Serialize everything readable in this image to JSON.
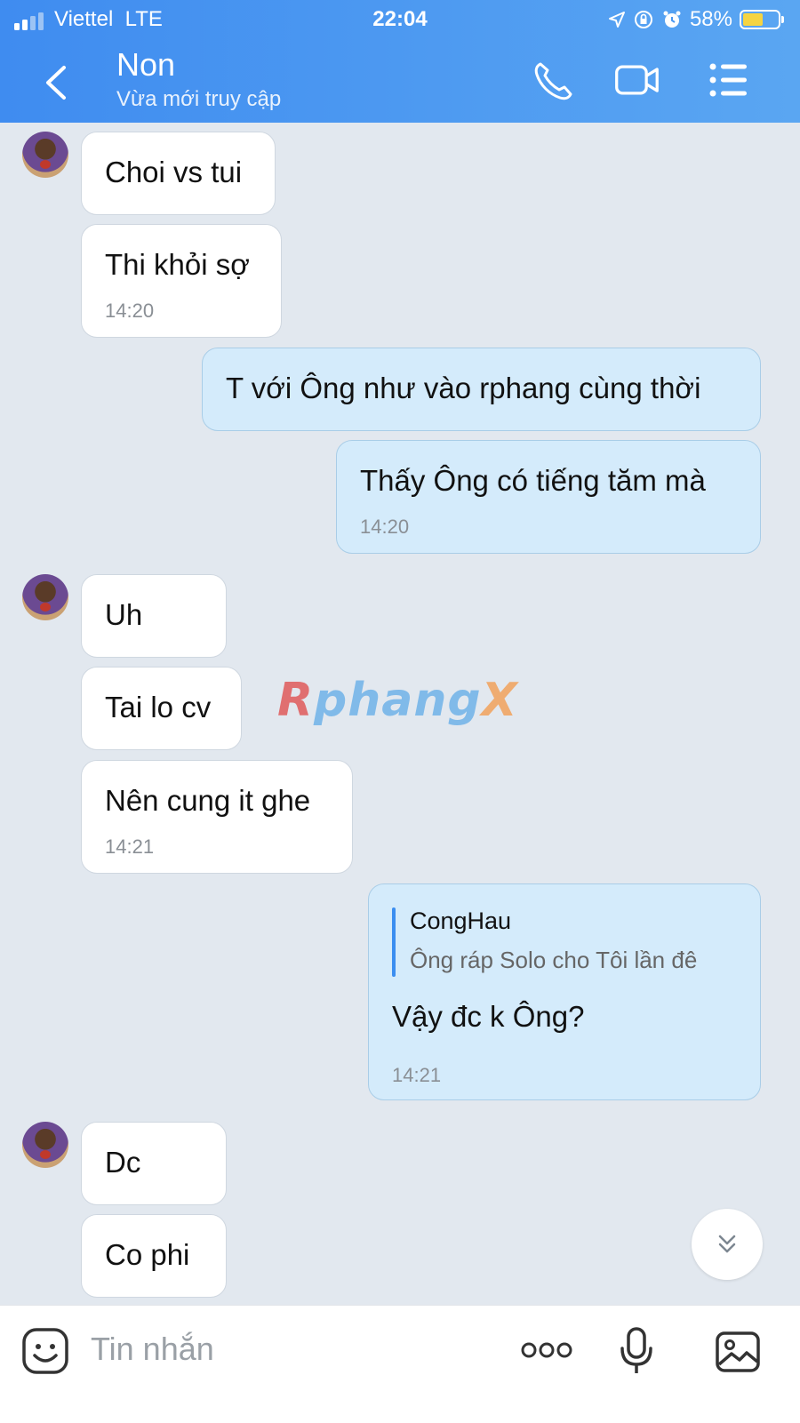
{
  "status_bar": {
    "carrier": "Viettel",
    "network": "LTE",
    "time": "22:04",
    "battery": "58%"
  },
  "header": {
    "title": "Non",
    "subtitle": "Vừa mới truy cập"
  },
  "messages": [
    {
      "from": "in",
      "text": "Choi vs tui"
    },
    {
      "from": "in",
      "text": "Thi khỏi sợ",
      "time": "14:20"
    },
    {
      "from": "out",
      "text": "T với Ông như vào rphang cùng thời"
    },
    {
      "from": "out",
      "text": "Thấy Ông có tiếng tăm mà",
      "time": "14:20"
    },
    {
      "from": "in",
      "text": "Uh"
    },
    {
      "from": "in",
      "text": "Tai lo cv"
    },
    {
      "from": "in",
      "text": "Nên cung it ghe",
      "time": "14:21"
    },
    {
      "from": "out",
      "quote_name": "CongHau",
      "quote_text": "Ông ráp Solo cho Tôi lần đê",
      "text": "Vậy đc k Ông?",
      "time": "14:21"
    },
    {
      "from": "in",
      "text": "Dc"
    },
    {
      "from": "in",
      "text": "Co phi"
    }
  ],
  "watermark": {
    "r": "R",
    "main": "phang",
    "x": "X"
  },
  "input": {
    "placeholder": "Tin nhắn"
  },
  "colors": {
    "header_start": "#3f8cf0",
    "header_end": "#5aa6f2",
    "outgoing_bubble": "#d4ebfb",
    "incoming_bubble": "#ffffff",
    "chat_bg": "#e2e8ef"
  }
}
